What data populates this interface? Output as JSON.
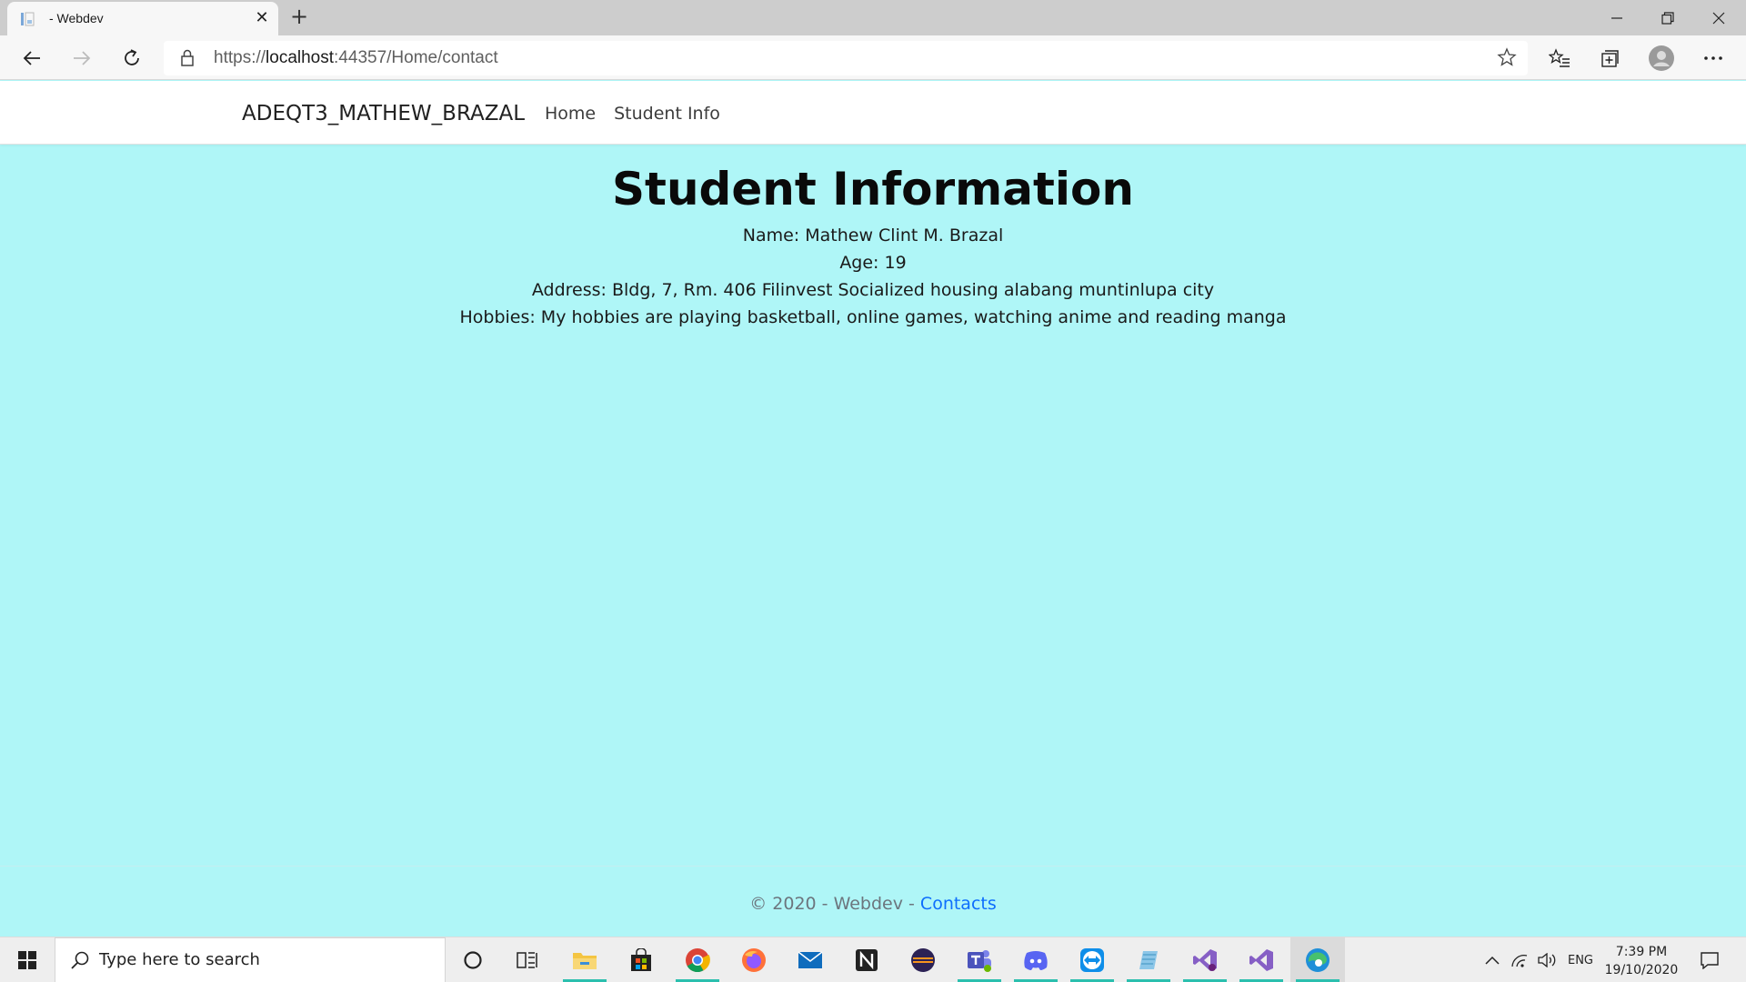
{
  "browser": {
    "tab_title": "- Webdev",
    "new_tab_label": "+",
    "close_label": "✕",
    "url_prefix": "https://",
    "url_host": "localhost",
    "url_rest": ":44357/Home/contact"
  },
  "site": {
    "brand": "ADEQT3_MATHEW_BRAZAL",
    "nav": [
      "Home",
      "Student Info"
    ]
  },
  "main": {
    "title": "Student Information",
    "name": "Name: Mathew Clint M. Brazal",
    "age": "Age: 19",
    "address": "Address: Bldg, 7, Rm. 406 Filinvest Socialized housing alabang muntinlupa city",
    "hobbies": "Hobbies: My hobbies are playing basketball, online games, watching anime and reading manga"
  },
  "footer": {
    "text": "© 2020 - Webdev - ",
    "link": "Contacts"
  },
  "taskbar": {
    "search_placeholder": "Type here to search",
    "language": "ENG",
    "time": "7:39 PM",
    "date": "19/10/2020",
    "apps": [
      "cortana-icon",
      "task-view-icon",
      "file-explorer-icon",
      "store-icon",
      "chrome-icon",
      "firefox-icon",
      "mail-icon",
      "notion-icon",
      "eclipse-icon",
      "teams-icon",
      "discord-icon",
      "teamviewer-icon",
      "notepad-icon",
      "visual-studio-icon",
      "visual-studio-icon",
      "edge-icon"
    ]
  },
  "colors": {
    "page_background": "#aff6f7",
    "link": "#0d6efd",
    "taskbar_indicator": "#2bbfae"
  }
}
